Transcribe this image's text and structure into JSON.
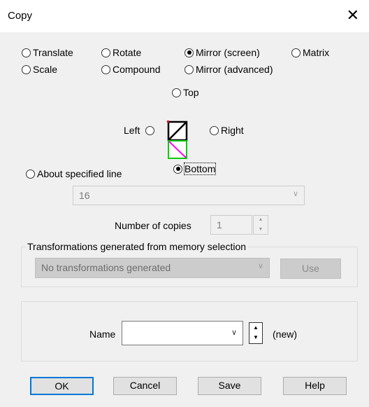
{
  "window": {
    "title": "Copy",
    "close_glyph": "✕"
  },
  "modes": {
    "translate": "Translate",
    "rotate": "Rotate",
    "mirror_screen": "Mirror (screen)",
    "matrix": "Matrix",
    "scale": "Scale",
    "compound": "Compound",
    "mirror_advanced": "Mirror (advanced)",
    "selected": "mirror_screen"
  },
  "mirror": {
    "top": "Top",
    "left": "Left",
    "right": "Right",
    "bottom": "Bottom",
    "selected": "bottom",
    "about_line": "About specified line",
    "line_value": "16"
  },
  "copies": {
    "label": "Number of copies",
    "value": "1"
  },
  "memory": {
    "label": "Transformations generated from memory selection",
    "value": "No transformations generated",
    "use_button": "Use"
  },
  "name": {
    "label": "Name",
    "value": "",
    "status": "(new)"
  },
  "buttons": {
    "ok": "OK",
    "cancel": "Cancel",
    "save": "Save",
    "help": "Help"
  },
  "icons": {
    "preview": "mirror-preview-icon",
    "colors": {
      "top": "#000000",
      "bottom": "#ff00ff",
      "frame": "#00cc00"
    }
  }
}
